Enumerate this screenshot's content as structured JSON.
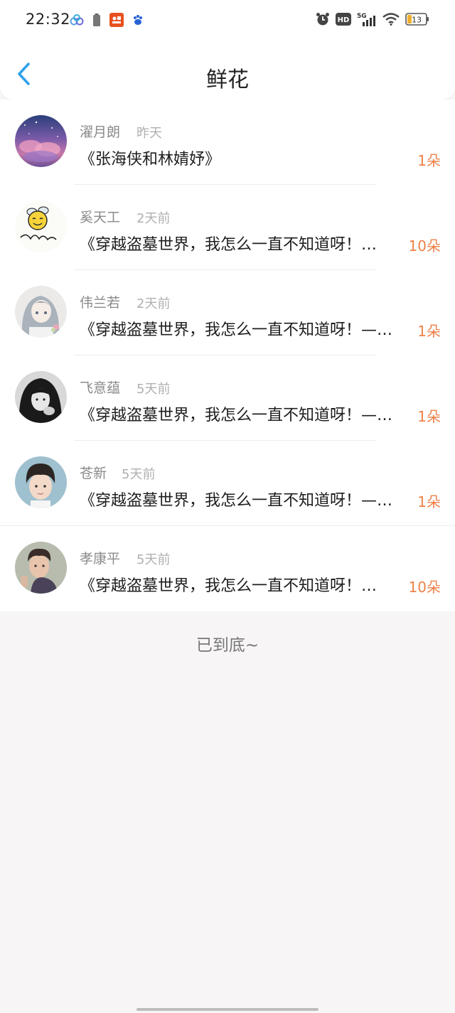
{
  "status_bar": {
    "time": "22:32",
    "battery_level": "13",
    "network": "5G",
    "hd_label": "HD",
    "left_icons": [
      "cloud-app-icon",
      "battery-saver-icon",
      "app-notification-icon",
      "baidu-icon"
    ],
    "right_icons": [
      "alarm-icon",
      "hd-icon",
      "signal-icon",
      "wifi-icon",
      "battery-icon"
    ]
  },
  "header": {
    "title": "鲜花",
    "back_icon": "chevron-left-icon",
    "accent_color": "#2ea1e8"
  },
  "list": {
    "items": [
      {
        "name": "濯月朗",
        "time": "昨天",
        "book": "《张海侠和林婧妤》",
        "count": "1朵",
        "avatar": "galaxy-sky-avatar"
      },
      {
        "name": "奚天工",
        "time": "2天前",
        "book": "《穿越盗墓世界，我怎么一直不知道呀！…",
        "count": "10朵",
        "avatar": "bee-logo-avatar"
      },
      {
        "name": "伟兰若",
        "time": "2天前",
        "book": "《穿越盗墓世界，我怎么一直不知道呀！—…",
        "count": "1朵",
        "avatar": "anime-girl-avatar"
      },
      {
        "name": "飞意蕴",
        "time": "5天前",
        "book": "《穿越盗墓世界，我怎么一直不知道呀！—…",
        "count": "1朵",
        "avatar": "bw-portrait-avatar"
      },
      {
        "name": "苍新",
        "time": "5天前",
        "book": "《穿越盗墓世界，我怎么一直不知道呀！—…",
        "count": "1朵",
        "avatar": "boy-portrait-avatar"
      },
      {
        "name": "孝康平",
        "time": "5天前",
        "book": "《穿越盗墓世界，我怎么一直不知道呀！…",
        "count": "10朵",
        "avatar": "man-portrait-avatar"
      }
    ],
    "count_color": "#ee8148"
  },
  "footer": {
    "end_text": "已到底~"
  }
}
